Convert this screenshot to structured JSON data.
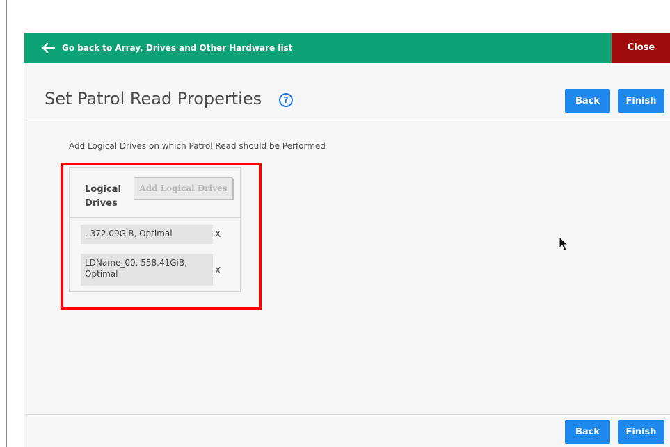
{
  "topbar": {
    "back_label": "Go back to Array, Drives and Other Hardware list",
    "close_label": "Close",
    "color": "#0da377",
    "close_color": "#a00c0c"
  },
  "header": {
    "title": "Set Patrol Read Properties",
    "help_glyph": "?",
    "back_label": "Back",
    "finish_label": "Finish"
  },
  "main": {
    "intro": "Add Logical Drives on which Patrol Read should be Performed",
    "logical_drives": {
      "title": "Logical Drives",
      "add_button_label": "Add Logical Drives",
      "items": [
        {
          "label": ", 372.09GiB, Optimal",
          "remove_glyph": "X"
        },
        {
          "label": "LDName_00, 558.41GiB, Optimal",
          "remove_glyph": "X"
        }
      ]
    }
  },
  "footer": {
    "back_label": "Back",
    "finish_label": "Finish"
  },
  "icons": {
    "back": "arrow-left-icon",
    "help": "help-circle-icon",
    "pointer": "mouse-pointer-icon"
  },
  "colors": {
    "accent": "#1e88ec",
    "highlight": "#ff0000"
  }
}
